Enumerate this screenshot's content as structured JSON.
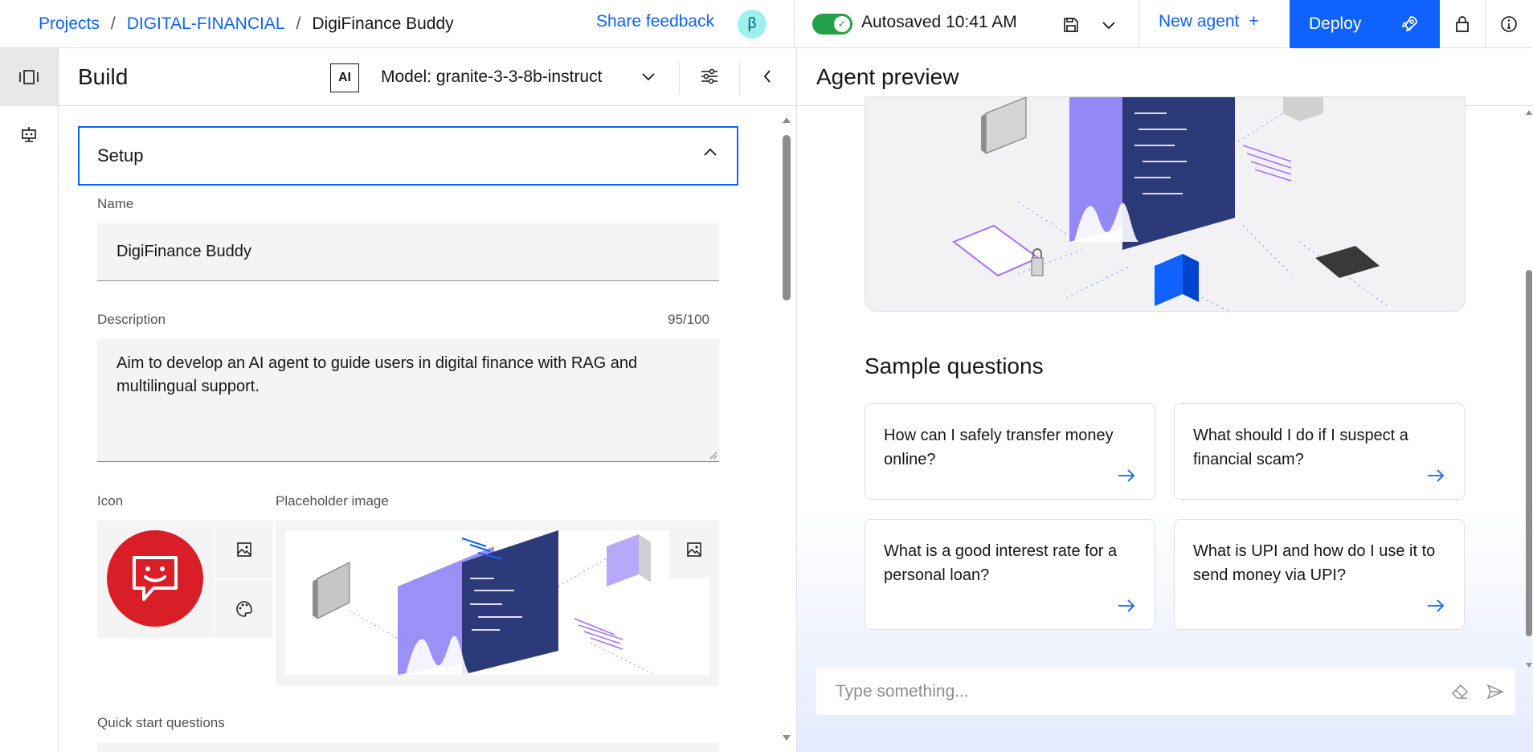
{
  "breadcrumb": {
    "projects": "Projects",
    "project": "DIGITAL-FINANCIAL",
    "current": "DigiFinance Buddy",
    "separator": "/"
  },
  "header": {
    "share_feedback": "Share feedback",
    "beta_badge": "β",
    "autosave": "Autosaved 10:41 AM",
    "new_agent": "New agent",
    "new_agent_plus": "+",
    "deploy": "Deploy"
  },
  "build": {
    "title": "Build",
    "ai_badge": "AI",
    "model_label": "Model: granite-3-3-8b-instruct",
    "setup_title": "Setup",
    "name_label": "Name",
    "name_value": "DigiFinance Buddy",
    "description_label": "Description",
    "description_count": "95/100",
    "description_value": "Aim to develop an AI agent to guide users in digital finance with RAG and multilingual support.",
    "icon_label": "Icon",
    "placeholder_image_label": "Placeholder image",
    "quick_start_label": "Quick start questions"
  },
  "preview": {
    "title": "Agent preview",
    "sample_title": "Sample questions",
    "questions": [
      "How can I safely transfer money online?",
      "What should I do if I suspect a financial scam?",
      "What is a good interest rate for a personal loan?",
      "What is UPI and how do I use it to send money via UPI?"
    ],
    "chat_placeholder": "Type something..."
  },
  "colors": {
    "accent": "#0f62fe",
    "success": "#24a148",
    "agent_icon_bg": "#da1e28",
    "beta_bg": "#9ef0f0"
  },
  "icons": [
    "save-icon",
    "chevron-down-icon",
    "rocket-icon",
    "lock-icon",
    "info-icon",
    "sliders-icon",
    "chevron-left-icon",
    "chevron-up-icon",
    "image-icon",
    "palette-icon",
    "arrow-right-icon",
    "eraser-icon",
    "send-icon"
  ]
}
